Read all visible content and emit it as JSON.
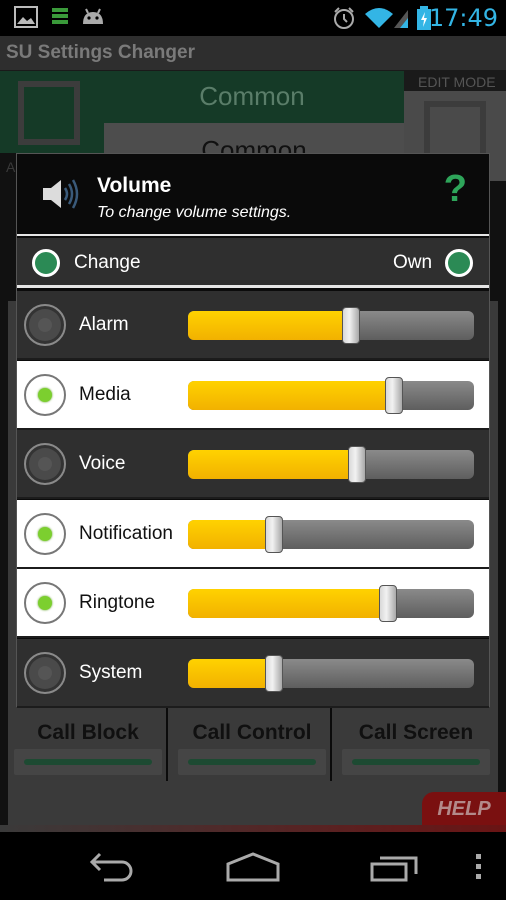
{
  "status_bar": {
    "time": "17:49",
    "left_icons": [
      "image-notification-icon",
      "storage-notification-icon",
      "android-notification-icon"
    ],
    "right_icons": [
      "alarm-icon",
      "wifi-icon",
      "signal-icon",
      "battery-charging-icon"
    ]
  },
  "app_bar": {
    "title": "SU Settings Changer"
  },
  "background": {
    "active_mode_title": "Common",
    "edit_mode_label": "EDIT MODE",
    "edit_mode_title": "Common",
    "active_mode_label": "ACTIVE MODE",
    "tiles": [
      {
        "label": "Call Block"
      },
      {
        "label": "Call Control"
      },
      {
        "label": "Call Screen"
      }
    ],
    "help_label": "HELP"
  },
  "dialog": {
    "title": "Volume",
    "subtitle": "To change volume settings.",
    "help_glyph": "?",
    "mode": {
      "left_label": "Change",
      "right_label": "Own"
    },
    "rows": [
      {
        "label": "Alarm",
        "enabled": false,
        "level": 0.57
      },
      {
        "label": "Media",
        "enabled": true,
        "level": 0.72
      },
      {
        "label": "Voice",
        "enabled": false,
        "level": 0.59
      },
      {
        "label": "Notification",
        "enabled": true,
        "level": 0.3
      },
      {
        "label": "Ringtone",
        "enabled": true,
        "level": 0.7
      },
      {
        "label": "System",
        "enabled": false,
        "level": 0.3
      }
    ]
  },
  "nav_bar": {
    "buttons": [
      "back-icon",
      "home-icon",
      "recents-icon",
      "overflow-menu-icon"
    ]
  }
}
